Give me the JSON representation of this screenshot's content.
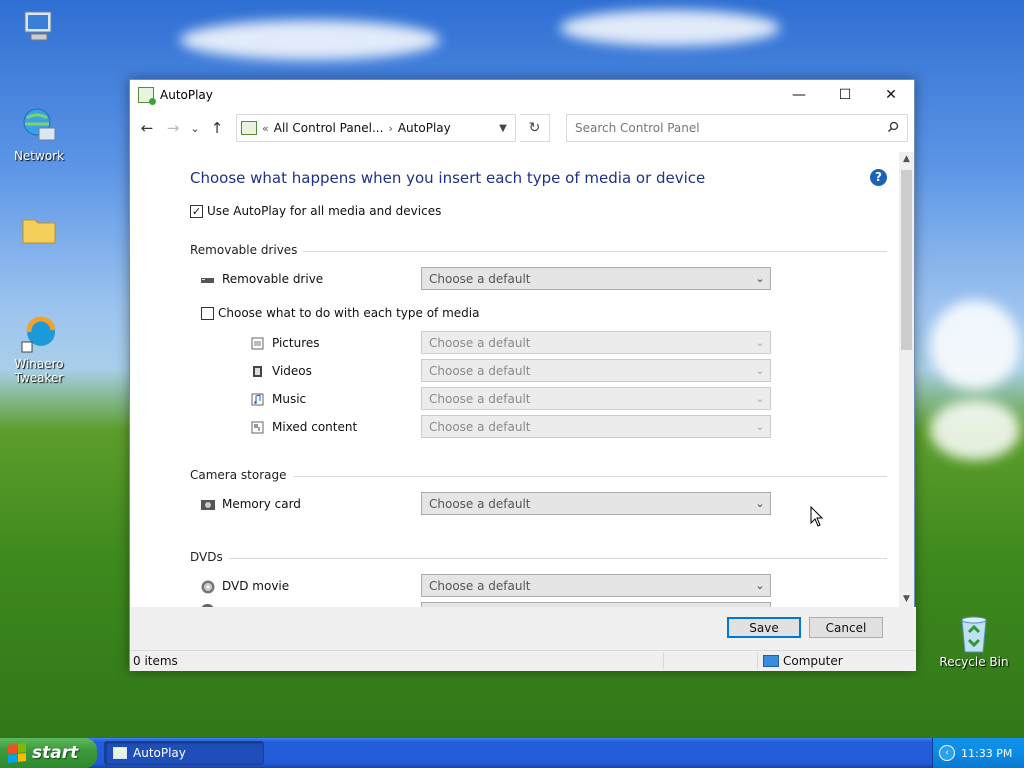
{
  "desktop": {
    "icons": [
      {
        "label": "",
        "icon": "computer-icon"
      },
      {
        "label": "Network",
        "icon": "network-icon"
      },
      {
        "label": "",
        "icon": "folder-icon"
      },
      {
        "label": "Winaero Tweaker",
        "icon": "winaero-tweaker-icon"
      },
      {
        "label": "Recycle Bin",
        "icon": "recycle-bin-icon"
      }
    ]
  },
  "window": {
    "title": "AutoPlay",
    "minimize_glyph": "—",
    "maximize_glyph": "☐",
    "close_glyph": "✕"
  },
  "navbar": {
    "back_glyph": "←",
    "forward_glyph": "→",
    "recent_glyph": "⌄",
    "up_glyph": "↑",
    "breadcrumb_prefix": "«",
    "breadcrumb_root": "All Control Panel...",
    "breadcrumb_sep": "›",
    "breadcrumb_current": "AutoPlay",
    "refresh_glyph": "↻",
    "search_placeholder": "Search Control Panel"
  },
  "content": {
    "heading": "Choose what happens when you insert each type of media or device",
    "help_glyph": "?",
    "use_autoplay_label": "Use AutoPlay for all media and devices",
    "use_autoplay_checked": true,
    "sections": {
      "removable": {
        "title": "Removable drives",
        "drive_label": "Removable drive",
        "drive_value": "Choose a default",
        "per_media_label": "Choose what to do with each type of media",
        "per_media_checked": false,
        "media": [
          {
            "label": "Pictures",
            "value": "Choose a default"
          },
          {
            "label": "Videos",
            "value": "Choose a default"
          },
          {
            "label": "Music",
            "value": "Choose a default"
          },
          {
            "label": "Mixed content",
            "value": "Choose a default"
          }
        ]
      },
      "camera": {
        "title": "Camera storage",
        "memory_card_label": "Memory card",
        "memory_card_value": "Choose a default"
      },
      "dvds": {
        "title": "DVDs",
        "dvd_movie_label": "DVD movie",
        "dvd_movie_value": "Choose a default"
      }
    }
  },
  "footer": {
    "save_label": "Save",
    "cancel_label": "Cancel"
  },
  "statusbar": {
    "items_text": "0 items",
    "location_text": "Computer"
  },
  "taskbar": {
    "start_label": "start",
    "task_label": "AutoPlay",
    "clock": "11:33 PM"
  },
  "colors": {
    "heading": "#1e3287",
    "accent": "#0078d7",
    "taskbar": "#245edc",
    "start_button": "#3c9a3c"
  }
}
